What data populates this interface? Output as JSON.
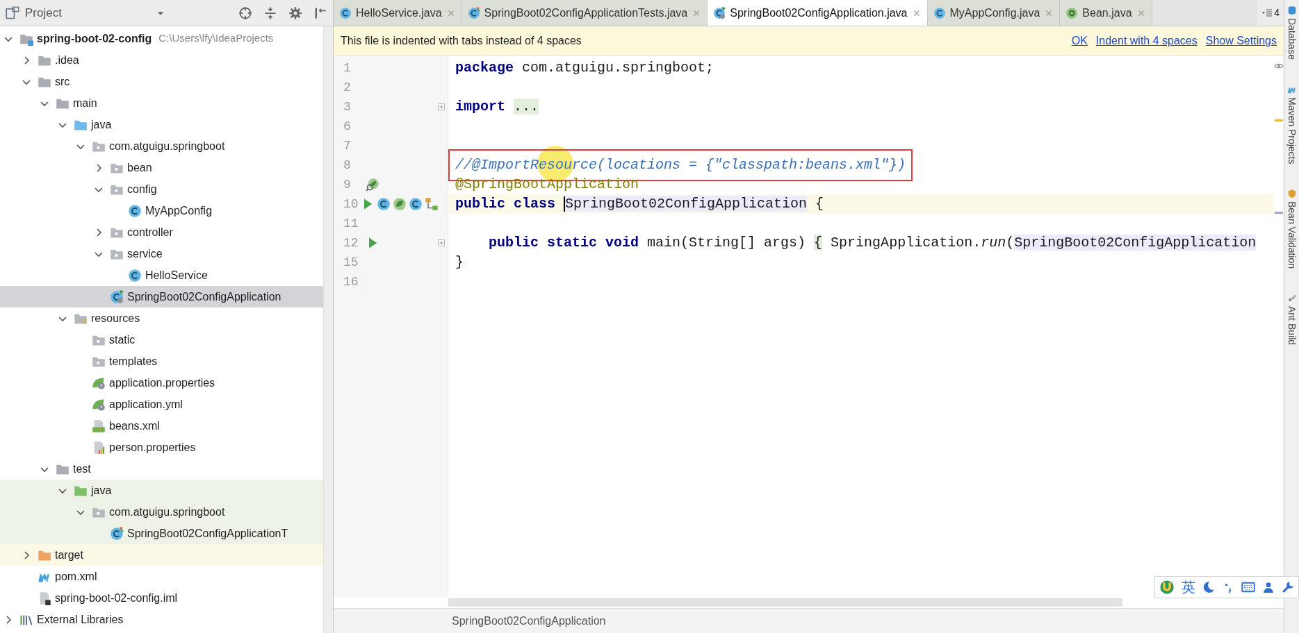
{
  "project_panel": {
    "title": "Project",
    "tree": [
      {
        "label": "spring-boot-02-config",
        "path": "C:\\Users\\lfy\\IdeaProjects",
        "kind": "module",
        "expanded": true,
        "selected": false,
        "children": [
          {
            "label": ".idea",
            "kind": "folder",
            "expanded": false,
            "selected": false
          },
          {
            "label": "src",
            "kind": "folder",
            "expanded": true,
            "selected": false,
            "children": [
              {
                "label": "main",
                "kind": "folder",
                "expanded": true,
                "selected": false,
                "children": [
                  {
                    "label": "java",
                    "kind": "source_root",
                    "expanded": true,
                    "selected": false,
                    "children": [
                      {
                        "label": "com.atguigu.springboot",
                        "kind": "package",
                        "expanded": true,
                        "selected": false,
                        "children": [
                          {
                            "label": "bean",
                            "kind": "package",
                            "expanded": false,
                            "selected": false
                          },
                          {
                            "label": "config",
                            "kind": "package",
                            "expanded": true,
                            "selected": false,
                            "children": [
                              {
                                "label": "MyAppConfig",
                                "kind": "class",
                                "selected": false
                              }
                            ]
                          },
                          {
                            "label": "controller",
                            "kind": "package",
                            "expanded": false,
                            "selected": false
                          },
                          {
                            "label": "service",
                            "kind": "package",
                            "expanded": true,
                            "selected": false,
                            "children": [
                              {
                                "label": "HelloService",
                                "kind": "class",
                                "selected": false
                              }
                            ]
                          },
                          {
                            "label": "SpringBoot02ConfigApplication",
                            "kind": "spring_class",
                            "selected": true
                          }
                        ]
                      }
                    ]
                  },
                  {
                    "label": "resources",
                    "kind": "resource_root",
                    "expanded": true,
                    "selected": false,
                    "children": [
                      {
                        "label": "static",
                        "kind": "package",
                        "selected": false
                      },
                      {
                        "label": "templates",
                        "kind": "package",
                        "selected": false
                      },
                      {
                        "label": "application.properties",
                        "kind": "spring_config",
                        "selected": false
                      },
                      {
                        "label": "application.yml",
                        "kind": "spring_config",
                        "selected": false
                      },
                      {
                        "label": "beans.xml",
                        "kind": "xml",
                        "selected": false
                      },
                      {
                        "label": "person.properties",
                        "kind": "properties",
                        "selected": false
                      }
                    ]
                  }
                ]
              },
              {
                "label": "test",
                "kind": "folder",
                "expanded": true,
                "selected": false,
                "children": [
                  {
                    "label": "java",
                    "kind": "test_root",
                    "expanded": true,
                    "selected": false,
                    "children": [
                      {
                        "label": "com.atguigu.springboot",
                        "kind": "test_package",
                        "expanded": true,
                        "selected": false,
                        "children": [
                          {
                            "label": "SpringBoot02ConfigApplicationT",
                            "kind": "test_class",
                            "selected": false
                          }
                        ]
                      }
                    ]
                  }
                ]
              }
            ]
          },
          {
            "label": "target",
            "kind": "excluded_folder",
            "expanded": false,
            "selected": false
          },
          {
            "label": "pom.xml",
            "kind": "maven",
            "selected": false
          },
          {
            "label": "spring-boot-02-config.iml",
            "kind": "iml",
            "selected": false
          }
        ]
      },
      {
        "label": "External Libraries",
        "kind": "libraries",
        "expanded": false,
        "selected": false
      }
    ]
  },
  "tabs": [
    {
      "label": "HelloService.java",
      "kind": "class",
      "selected": false
    },
    {
      "label": "SpringBoot02ConfigApplicationTests.java",
      "kind": "test_class",
      "selected": false
    },
    {
      "label": "SpringBoot02ConfigApplication.java",
      "kind": "spring_class",
      "selected": true
    },
    {
      "label": "MyAppConfig.java",
      "kind": "class",
      "selected": false
    },
    {
      "label": "Bean.java",
      "kind": "annotation",
      "selected": false
    }
  ],
  "tab_overflow": "4",
  "notification": {
    "message": "This file is indented with tabs instead of 4 spaces",
    "actions": [
      "OK",
      "Indent with 4 spaces",
      "Show Settings"
    ]
  },
  "code_lines": [
    {
      "number": "1",
      "current": false,
      "boxed": false,
      "folded": false,
      "tokens": [
        {
          "text": "package",
          "kind": "keyword"
        },
        {
          "text": " com.atguigu.springboot;",
          "kind": "plain"
        }
      ]
    },
    {
      "number": "2",
      "current": false,
      "boxed": false,
      "folded": false
    },
    {
      "number": "3",
      "current": false,
      "boxed": false,
      "folded": true,
      "tokens": [
        {
          "text": "import",
          "kind": "keyword"
        },
        {
          "text": "...",
          "kind": "folded"
        }
      ]
    },
    {
      "number": "6",
      "current": false,
      "boxed": false,
      "folded": false
    },
    {
      "number": "7",
      "current": false,
      "boxed": false,
      "folded": false
    },
    {
      "number": "8",
      "current": false,
      "boxed": true,
      "folded": false,
      "tokens": [
        {
          "text": "//@ImportResource(locations = {\"classpath:beans.xml\"})",
          "kind": "comment"
        }
      ]
    },
    {
      "number": "9",
      "current": false,
      "boxed": false,
      "folded": false,
      "gutter": [
        {
          "kind": "spring_bean"
        }
      ],
      "tokens": [
        {
          "text": "@SpringBootApplication",
          "kind": "annotation"
        }
      ]
    },
    {
      "number": "10",
      "current": true,
      "boxed": false,
      "folded": false,
      "gutter": [
        {
          "kind": "run"
        },
        {
          "kind": "class"
        },
        {
          "kind": "bean"
        },
        {
          "kind": "class"
        },
        {
          "kind": "hierarchy"
        }
      ],
      "tokens": [
        {
          "text": "public class ",
          "kind": "keyword"
        },
        {
          "text": "SpringBoot02ConfigApplication",
          "kind": "ref",
          "caret": true
        },
        {
          "text": " {",
          "kind": "plain"
        }
      ]
    },
    {
      "number": "11",
      "current": false,
      "boxed": false,
      "folded": false
    },
    {
      "number": "12",
      "current": false,
      "boxed": false,
      "folded": true,
      "gutter": [
        {
          "kind": "run"
        }
      ],
      "tokens": [
        {
          "text": "    public static void ",
          "kind": "keyword"
        },
        {
          "text": "main(String[] args) ",
          "kind": "plain"
        },
        {
          "text": "{",
          "kind": "folded_brace"
        },
        {
          "text": " SpringApplication.",
          "kind": "plain"
        },
        {
          "text": "run",
          "kind": "italic"
        },
        {
          "text": "(",
          "kind": "plain"
        },
        {
          "text": "SpringBoot02ConfigApplication",
          "kind": "ref"
        }
      ]
    },
    {
      "number": "15",
      "current": false,
      "boxed": false,
      "folded": false,
      "tokens": [
        {
          "text": "}",
          "kind": "plain"
        }
      ]
    },
    {
      "number": "16",
      "current": false,
      "boxed": false,
      "folded": false
    }
  ],
  "breadcrumb": "SpringBoot02ConfigApplication",
  "tool_windows": [
    {
      "label": "Database",
      "kind": "database"
    },
    {
      "label": "Maven Projects",
      "kind": "maven"
    },
    {
      "label": "Bean Validation",
      "kind": "bean_validation"
    },
    {
      "label": "Ant Build",
      "kind": "ant"
    }
  ],
  "input_method_bar": {
    "label": "英"
  }
}
